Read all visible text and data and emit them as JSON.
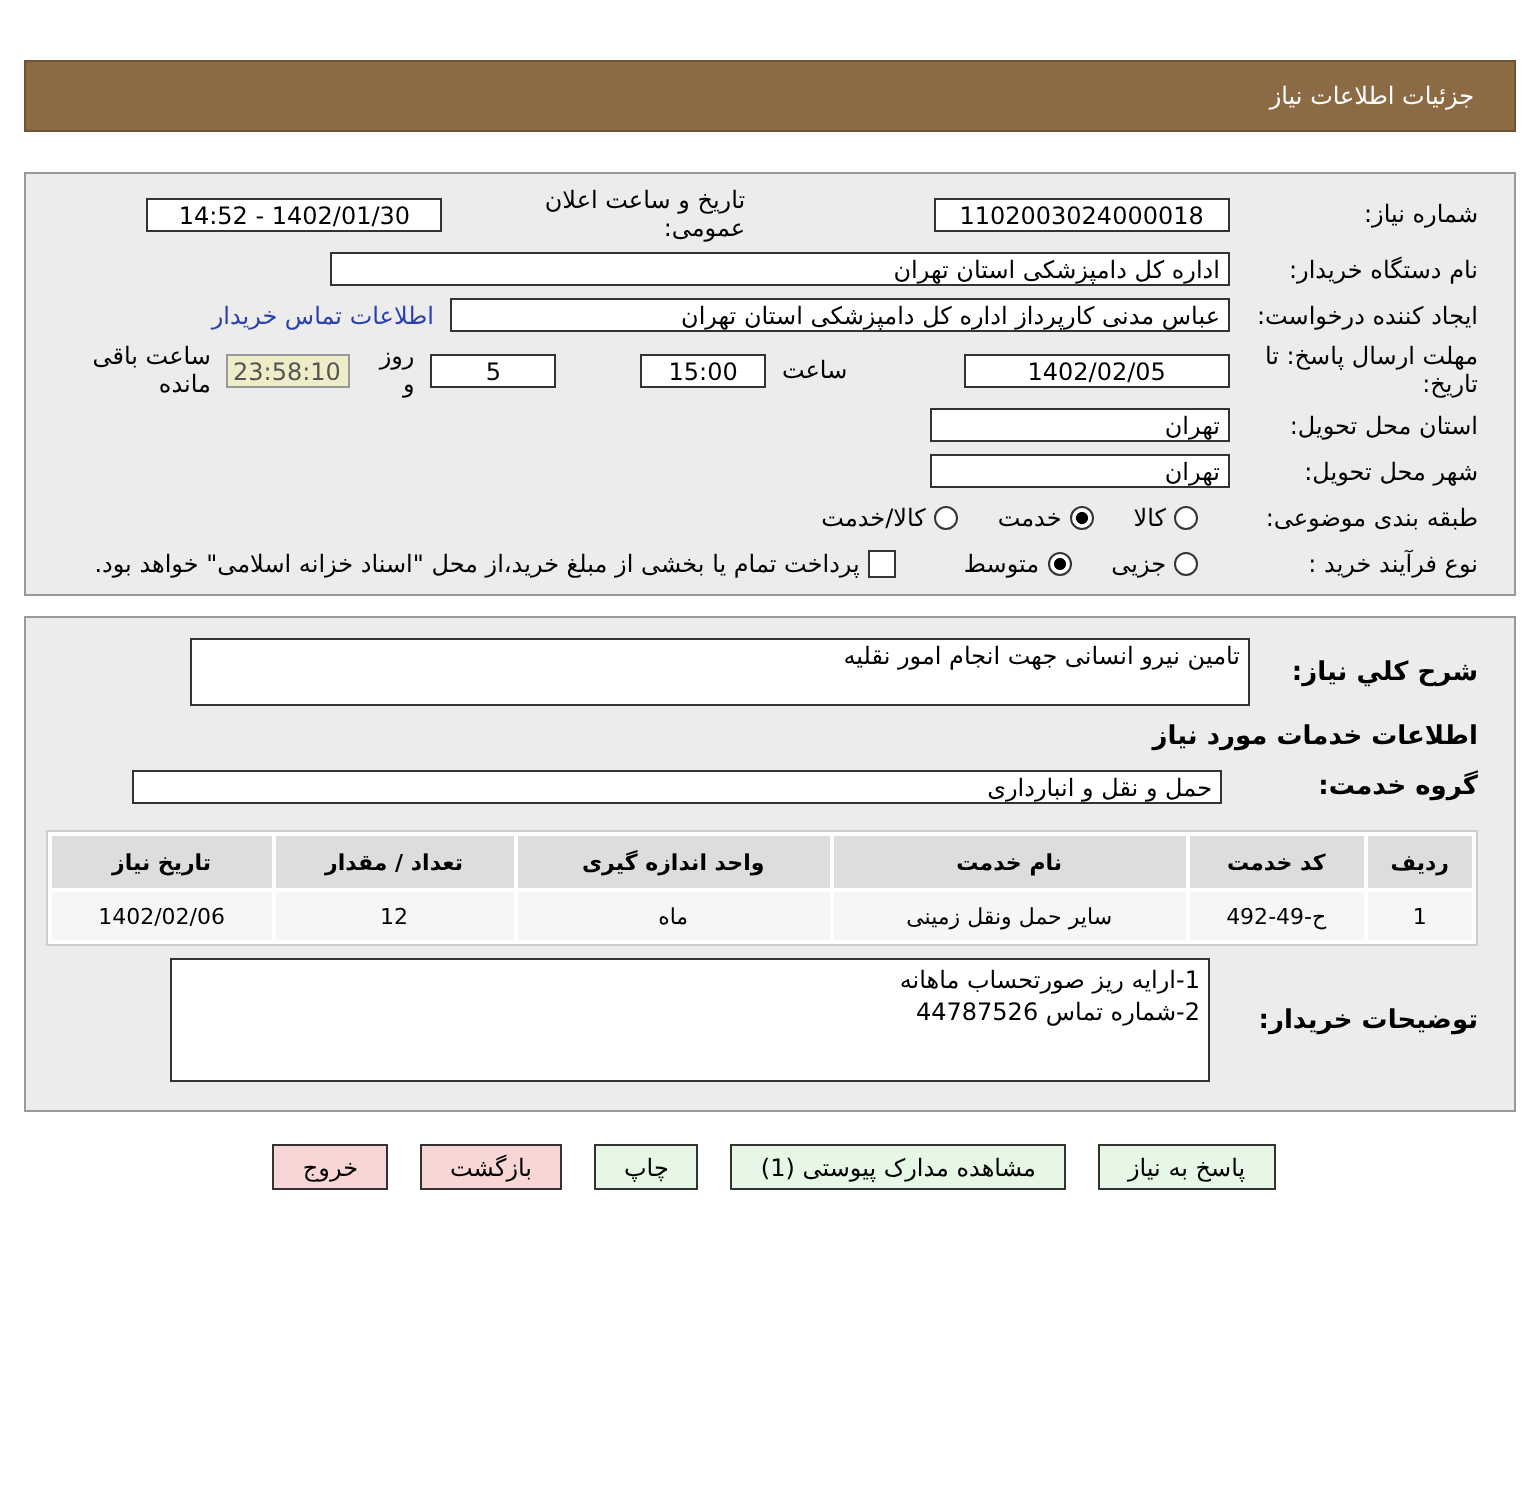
{
  "header": {
    "title": "جزئیات اطلاعات نیاز"
  },
  "fields": {
    "need_number_label": "شماره نیاز:",
    "need_number": "1102003024000018",
    "announce_label": "تاریخ و ساعت اعلان عمومی:",
    "announce": "1402/01/30 - 14:52",
    "buyer_org_label": "نام دستگاه خریدار:",
    "buyer_org": "اداره کل دامپزشکی استان تهران",
    "creator_label": "ایجاد کننده درخواست:",
    "creator": "عباس  مدنی کارپرداز اداره کل دامپزشکی استان تهران",
    "contact_link": "اطلاعات تماس خریدار",
    "deadline_label": "مهلت ارسال پاسخ: تا تاریخ:",
    "deadline_date": "1402/02/05",
    "time_label": "ساعت",
    "deadline_time": "15:00",
    "days": "5",
    "days_label": "روز و",
    "remaining": "23:58:10",
    "remaining_label": "ساعت باقی مانده",
    "province_label": "استان محل تحویل:",
    "province": "تهران",
    "city_label": "شهر محل تحویل:",
    "city": "تهران"
  },
  "category": {
    "label": "طبقه بندی موضوعی:",
    "options": [
      {
        "label": "کالا",
        "selected": false
      },
      {
        "label": "خدمت",
        "selected": true
      },
      {
        "label": "کالا/خدمت",
        "selected": false
      }
    ]
  },
  "purchase": {
    "label": "نوع فرآیند خرید :",
    "options": [
      {
        "label": "جزیی",
        "selected": false
      },
      {
        "label": "متوسط",
        "selected": true
      }
    ],
    "payment_checked": false,
    "payment_text": "پرداخت تمام یا بخشی از مبلغ خرید،از محل \"اسناد خزانه اسلامی\" خواهد بود."
  },
  "summary": {
    "label": "شرح کلي نیاز:",
    "value": "تامین نیرو انسانی جهت انجام امور نقلیه"
  },
  "services_heading": "اطلاعات خدمات مورد نیاز",
  "service_group": {
    "label": "گروه خدمت:",
    "value": "حمل و نقل و انبارداری"
  },
  "table": {
    "columns": [
      "ردیف",
      "کد خدمت",
      "نام خدمت",
      "واحد اندازه گیری",
      "تعداد / مقدار",
      "تاریخ نیاز"
    ],
    "rows": [
      [
        "1",
        "ح-49-492",
        "سایر حمل ونقل زمینی",
        "ماه",
        "12",
        "1402/02/06"
      ]
    ]
  },
  "notes": {
    "label": "توضیحات خریدار:",
    "lines": [
      "1-ارایه ریز صورتحساب ماهانه",
      "2-شماره تماس 44787526"
    ]
  },
  "buttons": [
    {
      "label": "پاسخ به نیاز",
      "kind": "green"
    },
    {
      "label": "مشاهده مدارک پیوستی (1)",
      "kind": "green"
    },
    {
      "label": "چاپ",
      "kind": "green"
    },
    {
      "label": "بازگشت",
      "kind": "red"
    },
    {
      "label": "خروج",
      "kind": "red"
    }
  ]
}
